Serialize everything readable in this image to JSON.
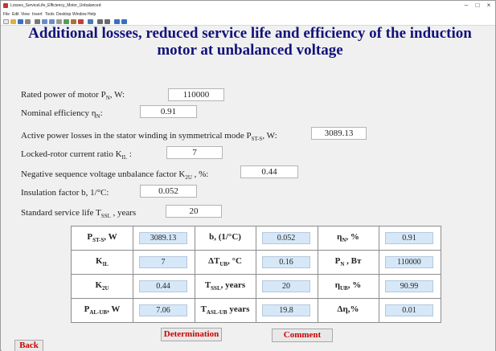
{
  "window": {
    "title": "Losses_ServiceLife_Efficiency_Motor_Unbalanced",
    "menu": [
      "File",
      "Edit",
      "View",
      "Insert",
      "Tools",
      "Desktop",
      "Window",
      "Help"
    ],
    "minimize": "–",
    "maximize": "□",
    "close": "×"
  },
  "heading": {
    "line1": "Additional losses, reduced service life and efficiency of the induction",
    "line2": "motor at unbalanced voltage"
  },
  "inputs": {
    "rated_power": {
      "label_pre": "Rated power of motor P",
      "label_sub": "N",
      "label_post": ", W:",
      "value": "110000"
    },
    "efficiency": {
      "label_pre": "Nominal efficiency η",
      "label_sub": "N",
      "label_post": ":",
      "value": "0.91"
    },
    "active_losses": {
      "label_pre": "Active power losses  in the stator winding in symmetrical mode P",
      "label_sub": "ST-S",
      "label_post": ", W:",
      "value": "3089.13"
    },
    "locked_rotor": {
      "label_pre": "Locked-rotor current ratio K",
      "label_sub": "IL",
      "label_post": " :",
      "value": "7"
    },
    "neg_seq": {
      "label_pre": "Negative sequence voltage unbalance factor K",
      "label_sub": "2U",
      "label_post": " , %:",
      "value": "0.44"
    },
    "insulation": {
      "label_pre": "Insulation factor b, 1/°C:",
      "label_sub": "",
      "label_post": "",
      "value": "0.052"
    },
    "service_life": {
      "label_pre": "Standard service life T",
      "label_sub": "SSL",
      "label_post": " , years",
      "value": "20"
    }
  },
  "results": {
    "rows": [
      [
        {
          "pre": "P",
          "sub": "ST-S",
          "post": ", W",
          "value": "3089.13"
        },
        {
          "pre": "b, (1/°C)",
          "sub": "",
          "post": "",
          "value": "0.052"
        },
        {
          "pre": "η",
          "sub": "N",
          "post": ", %",
          "value": "0.91"
        }
      ],
      [
        {
          "pre": "K",
          "sub": "IL",
          "post": "",
          "value": "7"
        },
        {
          "pre": "ΔT",
          "sub": "UB",
          "post": ", °C",
          "value": "0.16"
        },
        {
          "pre": "P",
          "sub": "N",
          "post": " , Вт",
          "value": "110000"
        }
      ],
      [
        {
          "pre": "K",
          "sub": "2U",
          "post": "",
          "value": "0.44"
        },
        {
          "pre": "T",
          "sub": "SSL",
          "post": ", years",
          "value": "20"
        },
        {
          "pre": "η",
          "sub": "UB",
          "post": ", %",
          "value": "90.99"
        }
      ],
      [
        {
          "pre": "P",
          "sub": "AL-UB",
          "post": ", W",
          "value": "7.06"
        },
        {
          "pre": "T",
          "sub": "ASL-UB",
          "post": " years",
          "value": "19.8"
        },
        {
          "pre": "Δη,%",
          "sub": "",
          "post": "",
          "value": "0.01"
        }
      ]
    ]
  },
  "buttons": {
    "determination": "Determination",
    "comment": "Comment",
    "back": "Back"
  },
  "colors": {
    "heading": "#13137a",
    "button_text": "#cc0000",
    "value_cell": "#d6e8f7",
    "background": "#f0f0f0"
  }
}
